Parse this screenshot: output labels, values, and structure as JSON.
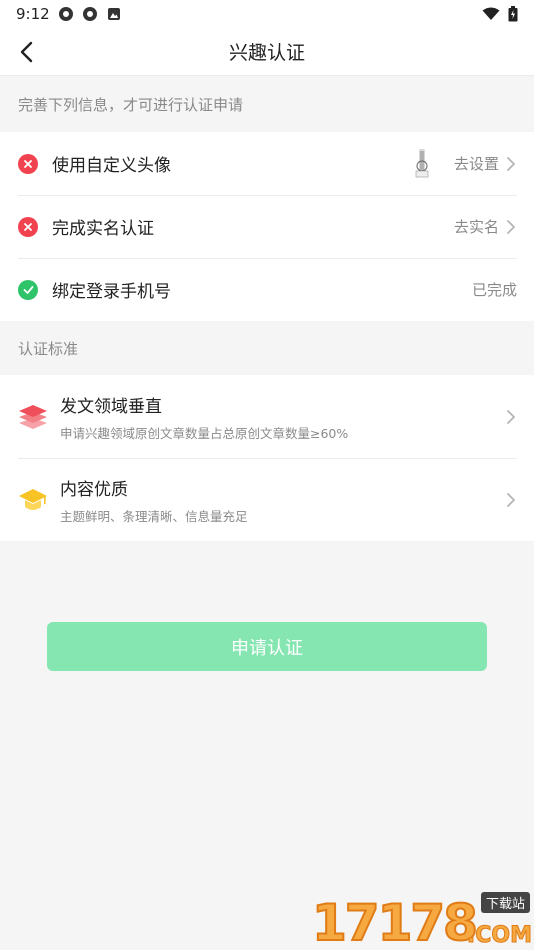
{
  "status_bar": {
    "time": "9:12"
  },
  "header": {
    "title": "兴趣认证"
  },
  "requirements": {
    "section_label": "完善下列信息，才可进行认证申请",
    "items": [
      {
        "label": "使用自定义头像",
        "status": "incomplete",
        "action": "去设置"
      },
      {
        "label": "完成实名认证",
        "status": "incomplete",
        "action": "去实名"
      },
      {
        "label": "绑定登录手机号",
        "status": "complete",
        "action": "已完成"
      }
    ]
  },
  "standards": {
    "section_label": "认证标准",
    "items": [
      {
        "title": "发文领域垂直",
        "subtitle": "申请兴趣领域原创文章数量占总原创文章数量≥60%",
        "icon": "layers-icon"
      },
      {
        "title": "内容优质",
        "subtitle": "主题鲜明、条理清晰、信息量充足",
        "icon": "graduation-cap-icon"
      }
    ]
  },
  "apply_button": {
    "label": "申请认证"
  },
  "watermark": {
    "digits": "17178",
    "tag": "下载站",
    "domain": ".COM"
  },
  "colors": {
    "error": "#f0434f",
    "success": "#2fc36a",
    "button_disabled": "#85e6b2"
  }
}
